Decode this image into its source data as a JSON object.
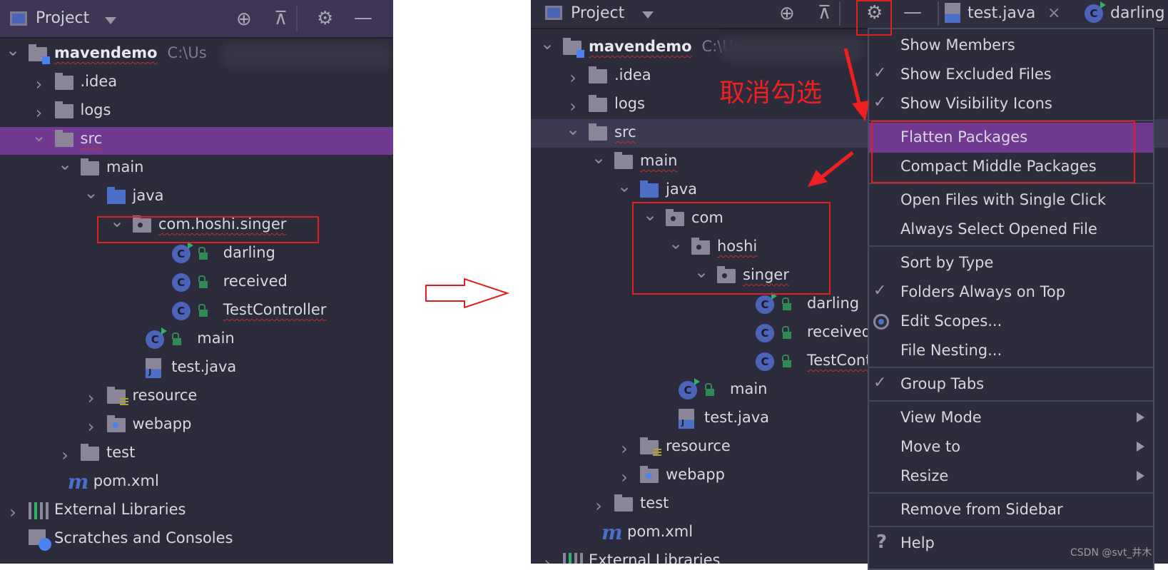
{
  "left": {
    "header": {
      "title": "Project",
      "icons": [
        "locate-icon",
        "collapse-all-icon",
        "gear-icon",
        "minimize-icon"
      ]
    },
    "tree": [
      {
        "label": "mavendemo",
        "path": "C:\\Us",
        "level": 0,
        "icon": "module-folder",
        "chevron": "down",
        "bold": true,
        "squiggle": true
      },
      {
        "label": ".idea",
        "level": 1,
        "icon": "folder",
        "chevron": "right"
      },
      {
        "label": "logs",
        "level": 1,
        "icon": "folder",
        "chevron": "right"
      },
      {
        "label": "src",
        "level": 1,
        "icon": "folder",
        "chevron": "down",
        "selected": true,
        "squiggle": true
      },
      {
        "label": "main",
        "level": 2,
        "icon": "folder",
        "chevron": "down"
      },
      {
        "label": "java",
        "level": 3,
        "icon": "java-folder",
        "chevron": "down"
      },
      {
        "label": "com.hoshi.singer",
        "level": 4,
        "icon": "package",
        "chevron": "down",
        "squiggle": true
      },
      {
        "label": "darling",
        "level": 5.5,
        "icon": "class-run",
        "lock": true
      },
      {
        "label": "received",
        "level": 5.5,
        "icon": "class",
        "lock": true
      },
      {
        "label": "TestController",
        "level": 5.5,
        "icon": "class",
        "lock": true,
        "squiggle": true
      },
      {
        "label": "main",
        "level": 4.5,
        "icon": "class-run",
        "lock": true
      },
      {
        "label": "test.java",
        "level": 4.5,
        "icon": "java-file"
      },
      {
        "label": "resource",
        "level": 3,
        "icon": "resource-folder",
        "chevron": "right"
      },
      {
        "label": "webapp",
        "level": 3,
        "icon": "web-folder",
        "chevron": "right"
      },
      {
        "label": "test",
        "level": 2,
        "icon": "folder",
        "chevron": "right"
      },
      {
        "label": "pom.xml",
        "level": 1.5,
        "icon": "maven"
      },
      {
        "label": "External Libraries",
        "level": 0,
        "icon": "libraries",
        "chevron": "right"
      },
      {
        "label": "Scratches and Consoles",
        "level": 0,
        "icon": "scratches"
      }
    ]
  },
  "right": {
    "header": {
      "title": "Project",
      "tabs": [
        {
          "label": "test.java",
          "icon": "java-file-icon",
          "close": "×"
        },
        {
          "label": "darling",
          "icon": "class-icon"
        }
      ]
    },
    "tree": [
      {
        "label": "mavendemo",
        "path": "C:\\Us",
        "level": 0,
        "icon": "module-folder",
        "chevron": "down",
        "bold": true,
        "squiggle": true
      },
      {
        "label": ".idea",
        "level": 1,
        "icon": "folder",
        "chevron": "right"
      },
      {
        "label": "logs",
        "level": 1,
        "icon": "folder",
        "chevron": "right"
      },
      {
        "label": "src",
        "level": 1,
        "icon": "folder",
        "chevron": "down",
        "selected": true,
        "squiggle": true
      },
      {
        "label": "main",
        "level": 2,
        "icon": "folder",
        "chevron": "down",
        "squiggle": true
      },
      {
        "label": "java",
        "level": 3,
        "icon": "java-folder",
        "chevron": "down"
      },
      {
        "label": "com",
        "level": 4,
        "icon": "package",
        "chevron": "down"
      },
      {
        "label": "hoshi",
        "level": 5,
        "icon": "package",
        "chevron": "down",
        "squiggle": true
      },
      {
        "label": "singer",
        "level": 6,
        "icon": "package",
        "chevron": "down",
        "squiggle": true
      },
      {
        "label": "darling",
        "level": 7.5,
        "icon": "class-run",
        "lock": true
      },
      {
        "label": "received",
        "level": 7.5,
        "icon": "class",
        "lock": true
      },
      {
        "label": "TestCont",
        "level": 7.5,
        "icon": "class",
        "lock": true,
        "squiggle": true
      },
      {
        "label": "main",
        "level": 4.5,
        "icon": "class-run",
        "lock": true
      },
      {
        "label": "test.java",
        "level": 4.5,
        "icon": "java-file"
      },
      {
        "label": "resource",
        "level": 3,
        "icon": "resource-folder",
        "chevron": "right"
      },
      {
        "label": "webapp",
        "level": 3,
        "icon": "web-folder",
        "chevron": "right"
      },
      {
        "label": "test",
        "level": 2,
        "icon": "folder",
        "chevron": "right"
      },
      {
        "label": "pom.xml",
        "level": 1.5,
        "icon": "maven"
      },
      {
        "label": "External Libraries",
        "level": 0,
        "icon": "libraries",
        "chevron": "right"
      }
    ]
  },
  "menu": {
    "groups": [
      [
        {
          "label": "Show Members"
        },
        {
          "label": "Show Excluded Files",
          "checked": true
        },
        {
          "label": "Show Visibility Icons",
          "checked": true
        }
      ],
      [
        {
          "label": "Flatten Packages",
          "highlighted": true
        },
        {
          "label": "Compact Middle Packages"
        }
      ],
      [
        {
          "label": "Open Files with Single Click"
        },
        {
          "label": "Always Select Opened File"
        }
      ],
      [
        {
          "label": "Sort by Type"
        },
        {
          "label": "Folders Always on Top",
          "checked": true
        },
        {
          "label": "Edit Scopes...",
          "radio": true
        },
        {
          "label": "File Nesting..."
        }
      ],
      [
        {
          "label": "Group Tabs",
          "checked": true
        }
      ],
      [
        {
          "label": "View Mode",
          "submenu": true
        },
        {
          "label": "Move to",
          "submenu": true
        },
        {
          "label": "Resize",
          "submenu": true
        }
      ],
      [
        {
          "label": "Remove from Sidebar"
        }
      ],
      [
        {
          "label": "Help",
          "help": true
        }
      ]
    ]
  },
  "annotation": {
    "note": "取消勾选",
    "color": "#e02020"
  },
  "watermark": "CSDN @svt_井木",
  "colors": {
    "background": "#2b2b3b",
    "selection": "#6f3a8f",
    "accent": "#4b63b8"
  }
}
